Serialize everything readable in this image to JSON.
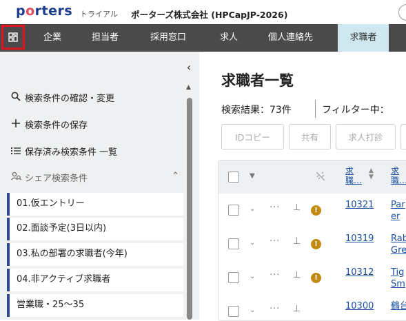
{
  "header": {
    "logo_prefix": "p",
    "logo_o": "o",
    "logo_suffix": "rters",
    "trial": "トライアル",
    "company": "ポーターズ株式会社 (HPCapJP-2026)"
  },
  "nav": {
    "items": [
      {
        "label": "企業"
      },
      {
        "label": "担当者"
      },
      {
        "label": "採用窓口"
      },
      {
        "label": "求人"
      },
      {
        "label": "個人連絡先"
      },
      {
        "label": "求職者"
      }
    ]
  },
  "sidebar": {
    "actions": [
      {
        "label": "検索条件の確認・変更",
        "icon": "search-icon"
      },
      {
        "label": "検索条件の保存",
        "icon": "plus-icon"
      },
      {
        "label": "保存済み検索条件 一覧",
        "icon": "list-icon"
      }
    ],
    "share_label": "シェア検索条件",
    "saved": [
      {
        "label": "01.仮エントリー"
      },
      {
        "label": "02.面談予定(3日以内)"
      },
      {
        "label": "03.私の部署の求職者(今年)"
      },
      {
        "label": "04.非アクティブ求職者"
      },
      {
        "label": "営業職・25〜35"
      }
    ]
  },
  "main": {
    "title": "求職者一覧",
    "result": "検索結果：73件",
    "filter": "フィルター中：",
    "buttons": [
      {
        "label": "IDコピー"
      },
      {
        "label": "共有"
      },
      {
        "label": "求人打診"
      }
    ],
    "table": {
      "col_id_line1": "求",
      "col_id_line2": "職…",
      "col_name_line1": "求",
      "col_name_line2": "職…",
      "rows": [
        {
          "id": "10321",
          "name1": "Par",
          "name2": "er"
        },
        {
          "id": "10319",
          "name1": "Rab",
          "name2": "Gre"
        },
        {
          "id": "10312",
          "name1": "Tig",
          "name2": "Sm"
        },
        {
          "id": "10300",
          "name1": "鶴台",
          "name2": ""
        }
      ]
    }
  },
  "colors": {
    "nav_bg": "#4a4a4a",
    "nav_active": "#cfe8ef",
    "brand": "#1b3b8c",
    "link": "#1a4fa0",
    "warning": "#c28a13",
    "highlight_border": "#e0141e"
  }
}
